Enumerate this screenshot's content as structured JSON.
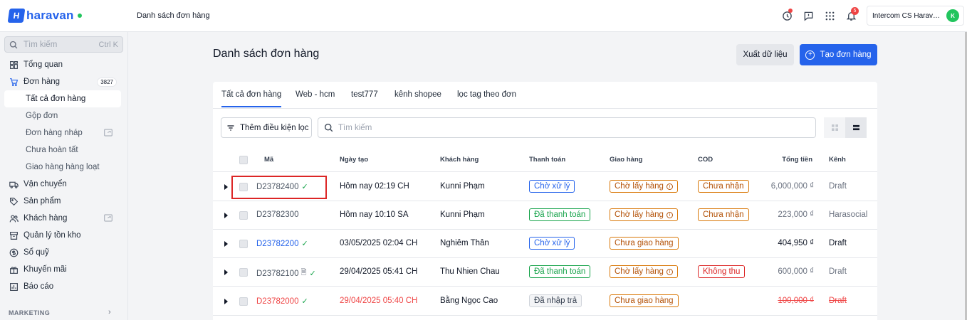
{
  "header": {
    "logo_text": "haravan",
    "page_title": "Danh sách đơn hàng",
    "bell_badge": "5",
    "account_name": "Intercom CS Haravan",
    "avatar_initial": "K"
  },
  "sidebar": {
    "search_placeholder": "Tìm kiếm",
    "search_shortcut": "Ctrl K",
    "items": [
      {
        "label": "Tổng quan"
      },
      {
        "label": "Đơn hàng",
        "badge": "3827"
      },
      {
        "label": "Tất cả đơn hàng"
      },
      {
        "label": "Gộp đơn"
      },
      {
        "label": "Đơn hàng nháp"
      },
      {
        "label": "Chưa hoàn tất"
      },
      {
        "label": "Giao hàng hàng loạt"
      },
      {
        "label": "Vận chuyển"
      },
      {
        "label": "Sản phẩm"
      },
      {
        "label": "Khách hàng"
      },
      {
        "label": "Quản lý tồn kho"
      },
      {
        "label": "Sổ quỹ"
      },
      {
        "label": "Khuyến mãi"
      },
      {
        "label": "Báo cáo"
      }
    ],
    "section_marketing": "MARKETING"
  },
  "main": {
    "title": "Danh sách đơn hàng",
    "export_label": "Xuất dữ liệu",
    "create_label": "Tạo đơn hàng",
    "tabs": [
      {
        "label": "Tất cả đơn hàng"
      },
      {
        "label": "Web - hcm"
      },
      {
        "label": "test777"
      },
      {
        "label": "kênh shopee"
      },
      {
        "label": "lọc tag theo đơn"
      }
    ],
    "filter_label": "Thêm điều kiện lọc",
    "search_placeholder": "Tìm kiếm",
    "columns": {
      "code": "Mã",
      "created": "Ngày tạo",
      "customer": "Khách hàng",
      "payment": "Thanh toán",
      "shipping": "Giao hàng",
      "cod": "COD",
      "total": "Tổng tiền",
      "channel": "Kênh"
    },
    "rows": [
      {
        "code": "D23782400",
        "created": "Hôm nay 02:19 CH",
        "customer": "Kunni Phạm",
        "payment": "Chờ xử lý",
        "shipping": "Chờ lấy hàng",
        "cod": "Chưa nhận",
        "total": "6,000,000 ₫",
        "channel": "Draft"
      },
      {
        "code": "D23782300",
        "created": "Hôm nay 10:10 SA",
        "customer": "Kunni Phạm",
        "payment": "Đã thanh toán",
        "shipping": "Chờ lấy hàng",
        "cod": "Chưa nhận",
        "total": "223,000 ₫",
        "channel": "Harasocial"
      },
      {
        "code": "D23782200",
        "created": "03/05/2025 02:04 CH",
        "customer": "Nghiêm Thân",
        "payment": "Chờ xử lý",
        "shipping": "Chưa giao hàng",
        "cod": "",
        "total": "404,950 ₫",
        "channel": "Draft"
      },
      {
        "code": "D23782100",
        "created": "29/04/2025 05:41 CH",
        "customer": "Thu Nhien Chau",
        "payment": "Đã thanh toán",
        "shipping": "Chờ lấy hàng",
        "cod": "Không thu",
        "total": "600,000 ₫",
        "channel": "Draft"
      },
      {
        "code": "D23782000",
        "created": "29/04/2025 05:40 CH",
        "customer": "Bằng Ngọc Cao",
        "payment": "Đã nhập trả",
        "shipping": "Chưa giao hàng",
        "cod": "",
        "total": "100,000 ₫",
        "channel": "Draft"
      }
    ]
  }
}
